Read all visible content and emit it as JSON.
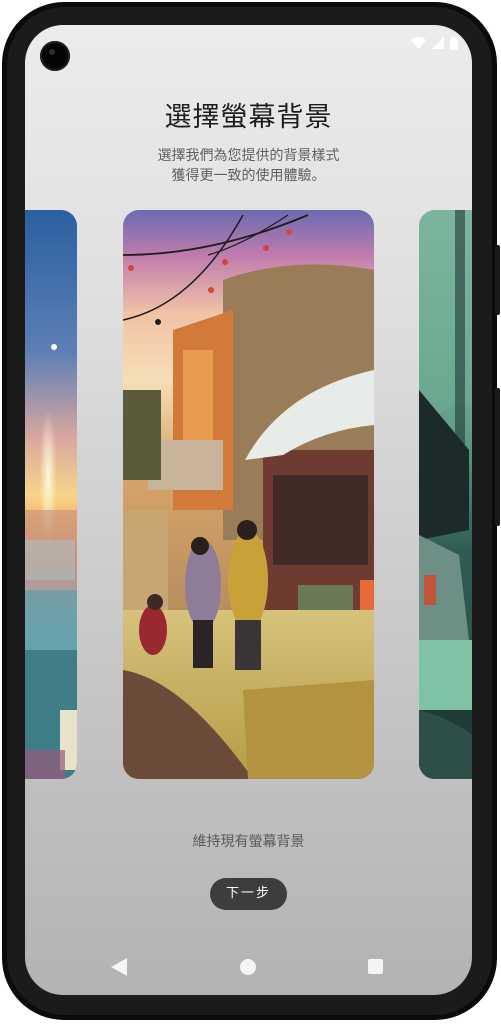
{
  "header": {
    "title": "選擇螢幕背景",
    "subtitle": "選擇我們為您提供的背景樣式\n獲得更一致的使用體驗。"
  },
  "wallpapers": {
    "items": [
      {
        "name": "sunset-coastal-town",
        "selected": false
      },
      {
        "name": "evening-alley-street",
        "selected": true
      },
      {
        "name": "green-forest-house",
        "selected": false
      }
    ]
  },
  "actions": {
    "keep_label": "維持現有螢幕背景",
    "next_label": "下一步"
  },
  "navbar": {
    "back": "back-icon",
    "home": "home-icon",
    "recents": "recents-icon"
  },
  "status_bar": {
    "icons": [
      "wifi-icon",
      "signal-icon",
      "battery-icon"
    ]
  }
}
